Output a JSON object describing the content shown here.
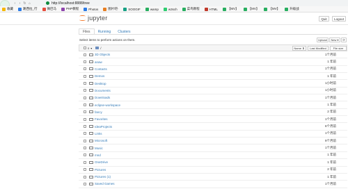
{
  "browser": {
    "url": "http://localhost:8888/tree",
    "bookmarks": [
      {
        "label": "收藏",
        "color": "#f5b800"
      },
      {
        "label": "路西拉_行",
        "color": "#2c7be5"
      },
      {
        "label": "微巴马",
        "color": "#e74c3c"
      },
      {
        "label": "PHP教程",
        "color": "#8e44ad"
      },
      {
        "label": "Photos",
        "color": "#2c7be5"
      },
      {
        "label": "图片吧·",
        "color": "#e67e22"
      },
      {
        "label": "SOOGIF",
        "color": "#16a085"
      },
      {
        "label": "wamp",
        "color": "#27ae60"
      },
      {
        "label": "w3sch",
        "color": "#2ecc71"
      },
      {
        "label": "菜鸟教程",
        "color": "#27ae60"
      },
      {
        "label": "HTML",
        "color": "#c0392b"
      },
      {
        "label": "【MV】",
        "color": "#27ae60"
      },
      {
        "label": "【MV】",
        "color": "#27ae60"
      },
      {
        "label": "【MV】",
        "color": "#27ae60"
      },
      {
        "label": "升级战",
        "color": "#27ae60"
      }
    ]
  },
  "header": {
    "app_name": "jupyter",
    "quit_label": "Quit",
    "logout_label": "Logout"
  },
  "tabs": [
    {
      "label": "Files",
      "active": true
    },
    {
      "label": "Running",
      "active": false
    },
    {
      "label": "Clusters",
      "active": false
    }
  ],
  "toolbar": {
    "message": "Select items to perform actions on them.",
    "upload_label": "Upload",
    "new_label": "New ▾",
    "refresh_icon": "⟳"
  },
  "list_header": {
    "count": "0",
    "path": "/",
    "name_label": "Name ⬇",
    "modified_label": "Last Modified",
    "size_label": "File size"
  },
  "files": [
    {
      "name": "3D Objects",
      "modified": "1个月前"
    },
    {
      "name": "anaw",
      "modified": "1 年前"
    },
    {
      "name": "Contacts",
      "modified": "1个月前"
    },
    {
      "name": "Demos",
      "modified": "1 年前"
    },
    {
      "name": "Desktop",
      "modified": "1小时前"
    },
    {
      "name": "Documents",
      "modified": "1小时前"
    },
    {
      "name": "Downloads",
      "modified": "1个月前"
    },
    {
      "name": "eclipse-workspace",
      "modified": "1 年前"
    },
    {
      "name": "fancy",
      "modified": "2 年前"
    },
    {
      "name": "Favorites",
      "modified": "1个月前"
    },
    {
      "name": "IdeaProjects",
      "modified": "6个月前"
    },
    {
      "name": "Links",
      "modified": "1个月前"
    },
    {
      "name": "Microsoft",
      "modified": "9个月前"
    },
    {
      "name": "Music",
      "modified": "1个月前"
    },
    {
      "name": "mnd",
      "modified": "1 年前"
    },
    {
      "name": "OneDrive",
      "modified": "1 年前"
    },
    {
      "name": "Pictures",
      "modified": "2 年前"
    },
    {
      "name": "Pictures (1)",
      "modified": "1 年前"
    },
    {
      "name": "Saved Games",
      "modified": "1个月前"
    }
  ]
}
